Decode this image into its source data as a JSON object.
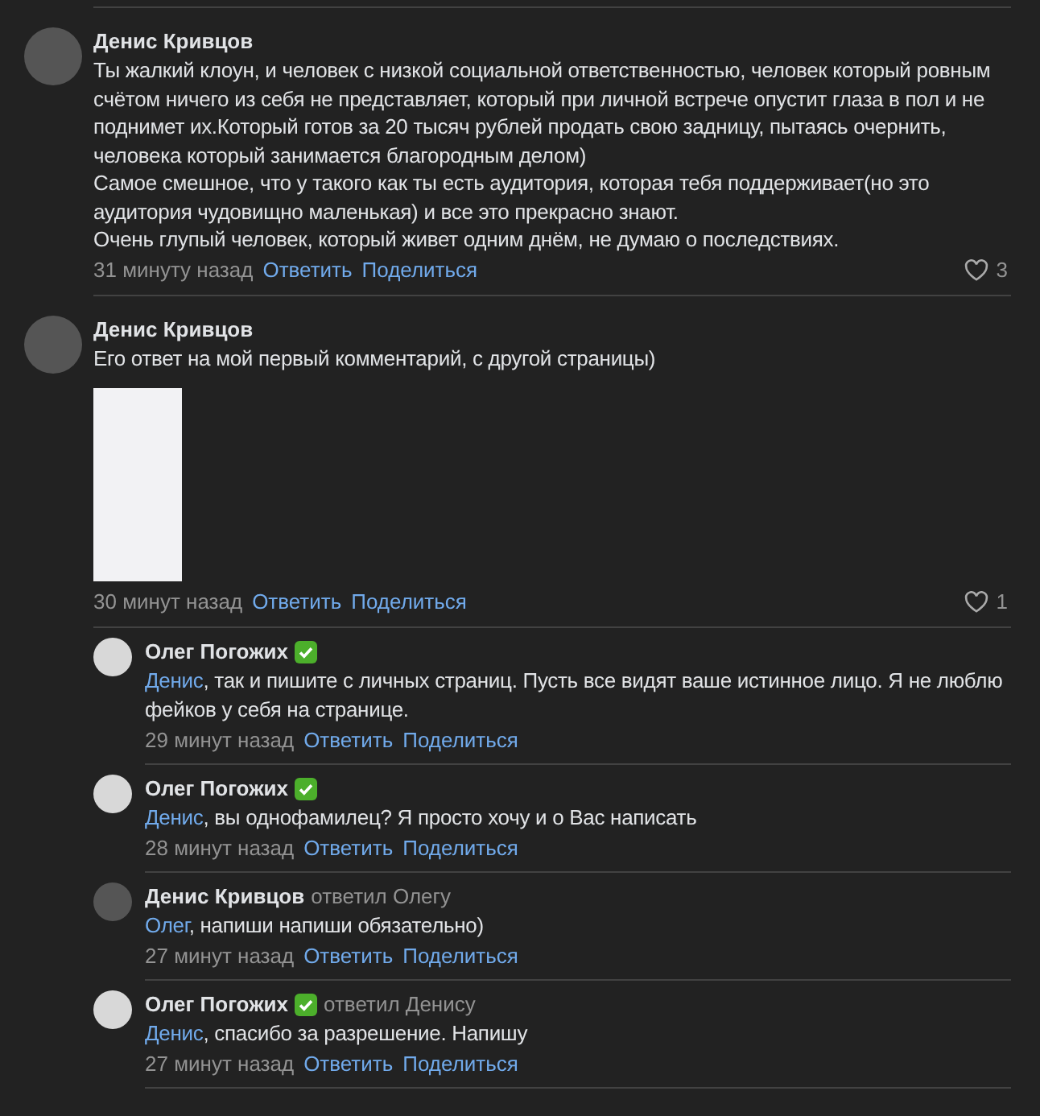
{
  "comments": [
    {
      "author": "Денис Кривцов",
      "verified": false,
      "text": "Ты жалкий клоун, и человек с низкой социальной ответственностью, человек который ровным счётом ничего из себя не представляет, который при личной встрече опустит глаза в пол и не поднимет их.Который готов за 20 тысяч рублей продать свою задницу, пытаясь очернить, человека который занимается благородным делом)\nСамое смешное, что у такого как ты есть аудитория, которая тебя поддерживает(но это аудитория чудовищно маленькая) и все это прекрасно знают.\nОчень глупый человек, который живет одним днём, не думаю о последствиях.",
      "attachment": false,
      "time": "31 минуту назад",
      "reply_action": "Ответить",
      "share_action": "Поделиться",
      "likes": "3"
    },
    {
      "author": "Денис Кривцов",
      "verified": false,
      "text": "Его ответ на мой первый комментарий, с другой страницы)",
      "attachment": true,
      "time": "30 минут назад",
      "reply_action": "Ответить",
      "share_action": "Поделиться",
      "likes": "1",
      "replies": [
        {
          "author": "Олег Погожих",
          "verified": true,
          "mention": "Денис",
          "text": ", так и пишите с личных страниц. Пусть все видят ваше истинное лицо. Я не люблю фейков у себя на странице.",
          "time": "29 минут назад",
          "reply_action": "Ответить",
          "share_action": "Поделиться"
        },
        {
          "author": "Олег Погожих",
          "verified": true,
          "mention": "Денис",
          "text": ", вы однофамилец? Я просто хочу и о Вас написать",
          "time": "28 минут назад",
          "reply_action": "Ответить",
          "share_action": "Поделиться"
        },
        {
          "author": "Денис Кривцов",
          "verified": false,
          "replied_to": "ответил Олегу",
          "mention": "Олег",
          "text": ", напиши напиши обязательно)",
          "time": "27 минут назад",
          "reply_action": "Ответить",
          "share_action": "Поделиться"
        },
        {
          "author": "Олег Погожих",
          "verified": true,
          "replied_to": "ответил Денису",
          "mention": "Денис",
          "text": ", спасибо за разрешение. Напишу",
          "time": "27 минут назад",
          "reply_action": "Ответить",
          "share_action": "Поделиться"
        }
      ]
    }
  ]
}
